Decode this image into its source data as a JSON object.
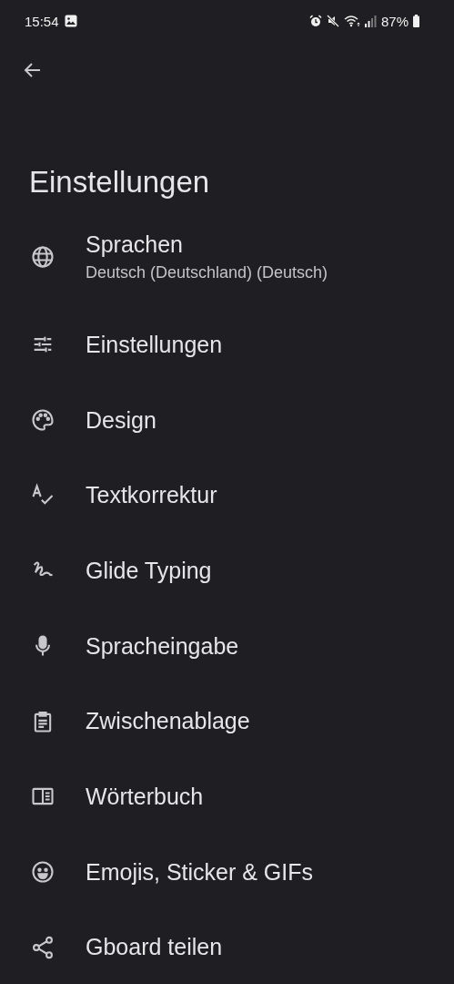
{
  "status_bar": {
    "time": "15:54",
    "battery": "87%"
  },
  "title": "Einstellungen",
  "items": [
    {
      "label": "Sprachen",
      "subtitle": "Deutsch (Deutschland) (Deutsch)"
    },
    {
      "label": "Einstellungen"
    },
    {
      "label": "Design"
    },
    {
      "label": "Textkorrektur"
    },
    {
      "label": "Glide Typing"
    },
    {
      "label": "Spracheingabe"
    },
    {
      "label": "Zwischenablage"
    },
    {
      "label": "Wörterbuch"
    },
    {
      "label": "Emojis, Sticker & GIFs"
    },
    {
      "label": "Gboard teilen"
    }
  ]
}
